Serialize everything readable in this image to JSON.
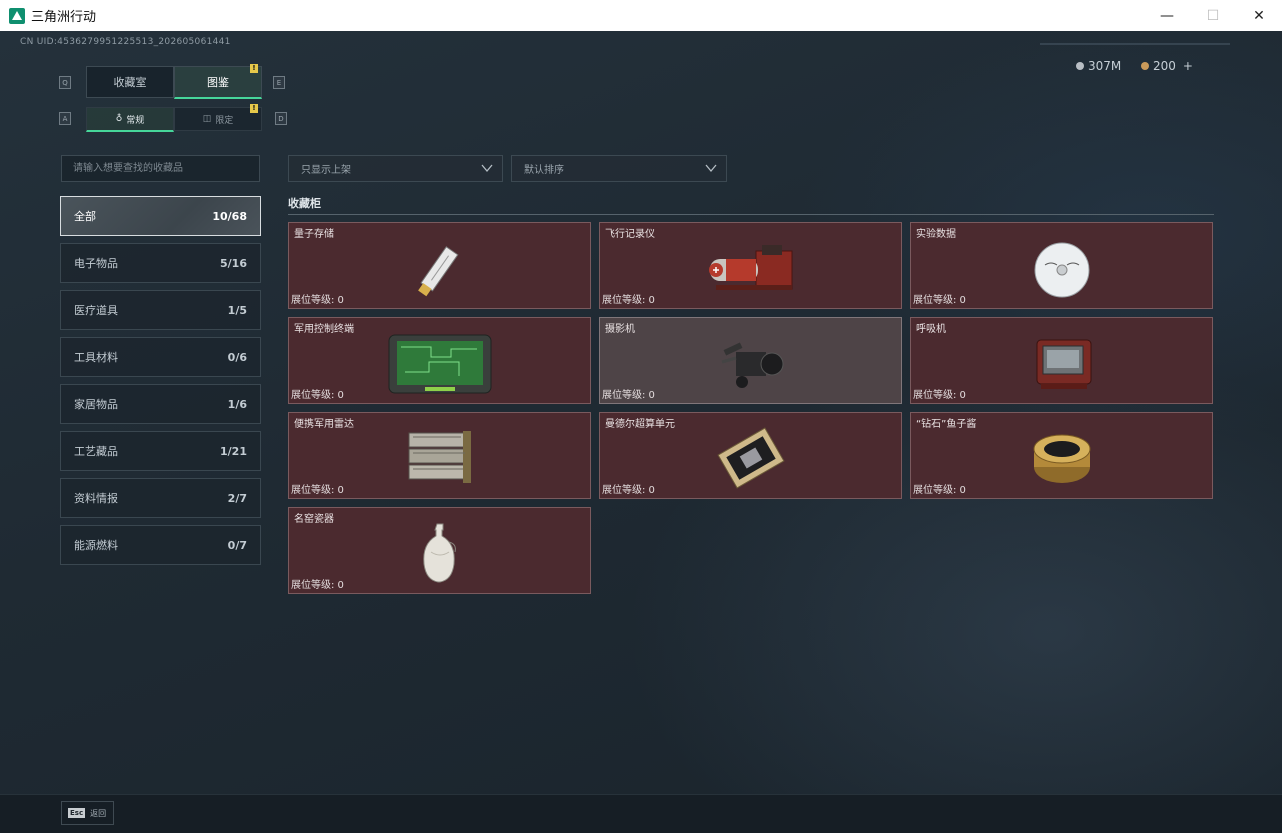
{
  "window": {
    "title": "三角洲行动",
    "min": "—",
    "max": "☐",
    "close": "✕"
  },
  "header": {
    "uid": "CN UID:4536279951225513_202605061441",
    "currency_1": "307M",
    "currency_2": "200",
    "plus": "+"
  },
  "tabs": {
    "key_left": "Q",
    "key_right": "E",
    "items": [
      {
        "label": "收藏室"
      },
      {
        "label": "图鉴"
      }
    ],
    "badge": "!"
  },
  "subtabs": {
    "key_left": "A",
    "key_right": "D",
    "items": [
      {
        "label": "常规"
      },
      {
        "label": "限定"
      }
    ],
    "badge": "!"
  },
  "search": {
    "placeholder": "请输入想要查找的收藏品"
  },
  "filters": {
    "shelf": "只显示上架",
    "sort": "默认排序"
  },
  "categories": [
    {
      "label": "全部",
      "count": "10/68"
    },
    {
      "label": "电子物品",
      "count": "5/16"
    },
    {
      "label": "医疗道具",
      "count": "1/5"
    },
    {
      "label": "工具材料",
      "count": "0/6"
    },
    {
      "label": "家居物品",
      "count": "1/6"
    },
    {
      "label": "工艺藏品",
      "count": "1/21"
    },
    {
      "label": "资料情报",
      "count": "2/7"
    },
    {
      "label": "能源燃料",
      "count": "0/7"
    }
  ],
  "section": {
    "title": "收藏柜"
  },
  "items": [
    {
      "name": "量子存储",
      "level": "展位等级: 0",
      "icon": "usb-drive-icon"
    },
    {
      "name": "飞行记录仪",
      "level": "展位等级: 0",
      "icon": "flight-recorder-icon"
    },
    {
      "name": "实验数据",
      "level": "展位等级: 0",
      "icon": "disc-icon"
    },
    {
      "name": "军用控制终端",
      "level": "展位等级: 0",
      "icon": "tablet-terminal-icon"
    },
    {
      "name": "摄影机",
      "level": "展位等级: 0",
      "icon": "camera-icon"
    },
    {
      "name": "呼吸机",
      "level": "展位等级: 0",
      "icon": "ventilator-icon"
    },
    {
      "name": "便携军用雷达",
      "level": "展位等级: 0",
      "icon": "radar-icon"
    },
    {
      "name": "曼德尔超算单元",
      "level": "展位等级: 0",
      "icon": "gpu-card-icon"
    },
    {
      "name": "“钻石”鱼子酱",
      "level": "展位等级: 0",
      "icon": "caviar-tin-icon"
    },
    {
      "name": "名窑瓷器",
      "level": "展位等级: 0",
      "icon": "porcelain-vase-icon"
    }
  ],
  "bottom": {
    "esc_key": "Esc",
    "esc_label": "返回"
  },
  "colors": {
    "accent": "#46d69a",
    "card_bg": "#4b2a2f",
    "badge": "#e6c84a"
  }
}
